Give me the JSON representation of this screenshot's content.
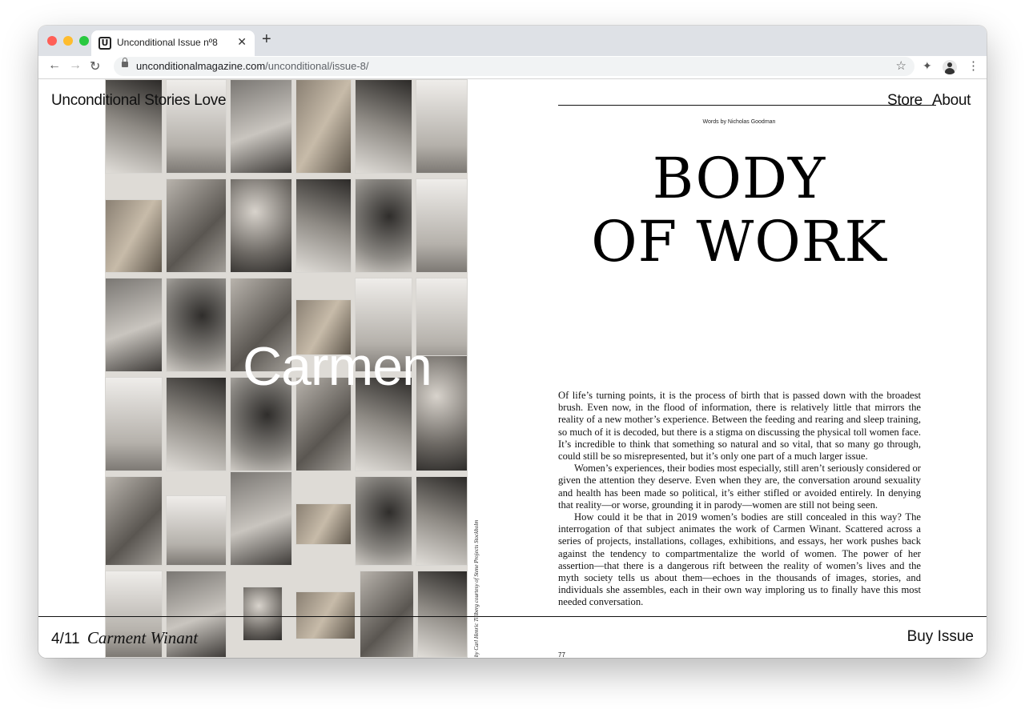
{
  "browser": {
    "tab_title": "Unconditional Issue nº8",
    "tab_logo": "U",
    "url_domain": "unconditionalmagazine.com",
    "url_path": "/unconditional/issue-8/",
    "icons": [
      "back-arrow-icon",
      "forward-arrow-icon",
      "reload-icon",
      "lock-icon",
      "star-icon",
      "extensions-icon",
      "profile-icon",
      "more-menu-icon",
      "close-icon",
      "plus-icon"
    ],
    "traffic_light_colors": [
      "#ff5f57",
      "#febc2e",
      "#28c840"
    ]
  },
  "site": {
    "title": "Unconditional Stories Love",
    "nav": [
      "Store",
      "About"
    ]
  },
  "left_page": {
    "overlay_name": "Carmen",
    "photo_credit": "Photographs by Carl Henric Tillberg courtesy of Stene Projects Stockholm"
  },
  "article": {
    "byline": "Words by Nicholas Goodman",
    "headline_line1": "BODY",
    "headline_line2": "OF WORK",
    "paragraphs": [
      "Of life’s turning points, it is the process of birth that is passed down with the broadest brush. Even now, in the flood of information, there is relatively little that mirrors the reality of a new mother’s experience. Between the feeding and rearing and sleep training, so much of it is decoded, but there is a stigma on discussing the physical toll women face. It’s incredible to think that something so natural and so vital, that so many go through, could still be so misrepresented, but it’s only one part of a much larger issue.",
      "Women’s experiences, their bodies most especially, still aren’t seriously considered or given the attention they deserve. Even when they are, the conversation around sexuality and health has been made so political, it’s either stifled or avoided entirely. In denying that reality—or worse, grounding it in parody—women are still not being seen.",
      "How could it be that in 2019 women’s bodies are still concealed in this way? The interrogation of that subject animates the work of Carmen Winant. Scattered across a series of projects, installations, collages, exhibitions, and essays, her work pushes back against the tendency to compartmentalize the world of women. The power of her assertion—that there is a dangerous rift between the reality of women’s lives and the myth society tells us about them—echoes in the thousands of images, stories, and individuals she assembles, each in their own way imploring us to finally have this most needed conversation."
    ],
    "page_number": "77"
  },
  "footer": {
    "counter": "4/11",
    "artist": "Carment Winant",
    "buy_label": "Buy Issue"
  }
}
